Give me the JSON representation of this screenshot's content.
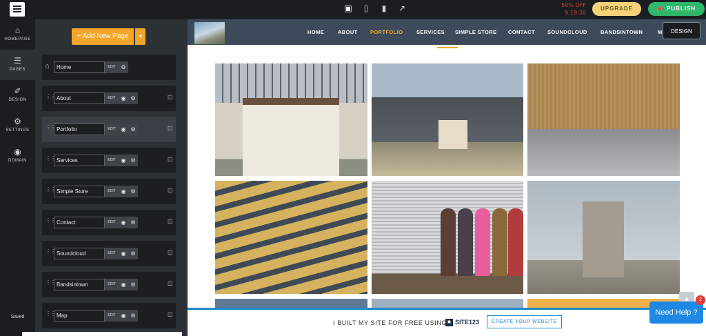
{
  "topbar": {
    "devices": [
      "desktop-icon",
      "tablet-icon",
      "mobile-icon",
      "external-link-icon"
    ],
    "offer": {
      "discount": "50% OFF",
      "countdown": "9:19:30"
    },
    "upgrade_label": "UPGRADE",
    "publish_label": "PUBLISH"
  },
  "rail": {
    "items": [
      {
        "label": "HOMEPAGE",
        "icon": "home-icon"
      },
      {
        "label": "PAGES",
        "icon": "pages-icon"
      },
      {
        "label": "DESIGN",
        "icon": "brush-icon"
      },
      {
        "label": "SETTINGS",
        "icon": "gear-icon"
      },
      {
        "label": "DOMAIN",
        "icon": "globe-icon"
      }
    ],
    "saved_label": "Saved"
  },
  "pages_panel": {
    "add_page_label": "+ Add New Page",
    "edit_label": "EDIT",
    "pages": [
      {
        "name": "Home"
      },
      {
        "name": "About"
      },
      {
        "name": "Portfolio"
      },
      {
        "name": "Services"
      },
      {
        "name": "Simple Store"
      },
      {
        "name": "Contact"
      },
      {
        "name": "Soundcloud"
      },
      {
        "name": "Bandsintown"
      },
      {
        "name": "Map"
      }
    ]
  },
  "site": {
    "nav": [
      "HOME",
      "ABOUT",
      "PORTFOLIO",
      "SERVICES",
      "SIMPLE STORE",
      "CONTACT",
      "SOUNDCLOUD",
      "BANDSINTOWN",
      "M"
    ],
    "current_nav": "PORTFOLIO",
    "design_label": "DESIGN",
    "footer": {
      "text": "I BUILT MY SITE FOR FREE USING",
      "brand": "SITE123",
      "cta": "CREATE YOUR WEBSITE"
    }
  },
  "help": {
    "label": "Need Help ?",
    "badge": "2"
  },
  "colors": {
    "accent": "#f4a62a",
    "publish": "#2fb86a",
    "upgrade": "#f5d27a",
    "offer": "#e53935",
    "link": "#1e88c8"
  }
}
